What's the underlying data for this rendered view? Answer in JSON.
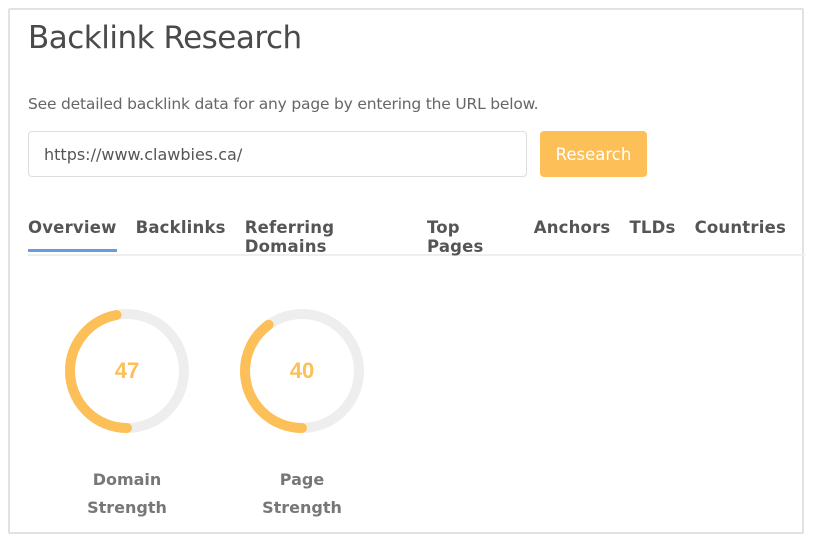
{
  "title": "Backlink Research",
  "description": "See detailed backlink data for any page by entering the URL below.",
  "url_input": {
    "value": "https://www.clawbies.ca/"
  },
  "research_button": "Research",
  "tabs": [
    {
      "label": "Overview",
      "active": true
    },
    {
      "label": "Backlinks"
    },
    {
      "label": "Referring Domains"
    },
    {
      "label": "Top Pages"
    },
    {
      "label": "Anchors"
    },
    {
      "label": "TLDs"
    },
    {
      "label": "Countries"
    }
  ],
  "gauges": [
    {
      "value": 47,
      "label_line1": "Domain",
      "label_line2": "Strength"
    },
    {
      "value": 40,
      "label_line1": "Page",
      "label_line2": "Strength"
    }
  ],
  "colors": {
    "accent": "#fdbf57",
    "track": "#eeeeee",
    "tab_active": "#6a9be0"
  }
}
